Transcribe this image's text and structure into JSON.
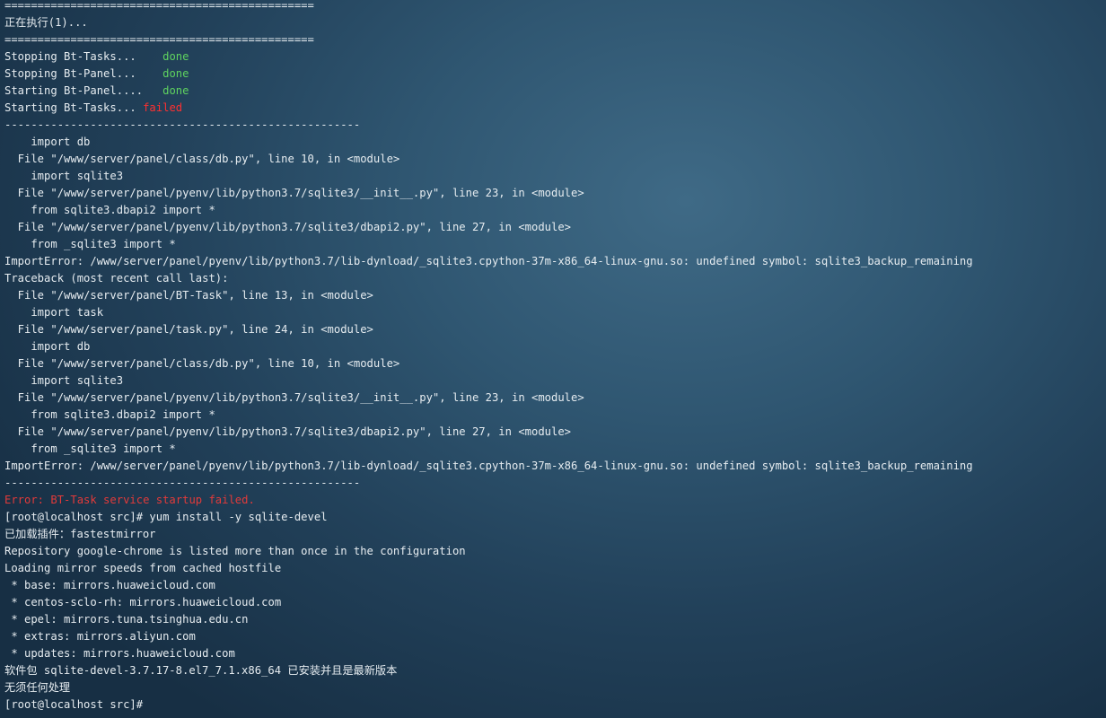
{
  "terminal": {
    "lines": [
      "===============================================",
      "正在执行(1)...",
      "===============================================",
      "Stopping Bt-Tasks...    ",
      "Stopping Bt-Panel...    ",
      "Starting Bt-Panel....   ",
      "Starting Bt-Tasks... ",
      "------------------------------------------------------",
      "    import db",
      "  File \"/www/server/panel/class/db.py\", line 10, in <module>",
      "    import sqlite3",
      "  File \"/www/server/panel/pyenv/lib/python3.7/sqlite3/__init__.py\", line 23, in <module>",
      "    from sqlite3.dbapi2 import *",
      "  File \"/www/server/panel/pyenv/lib/python3.7/sqlite3/dbapi2.py\", line 27, in <module>",
      "    from _sqlite3 import *",
      "ImportError: /www/server/panel/pyenv/lib/python3.7/lib-dynload/_sqlite3.cpython-37m-x86_64-linux-gnu.so: undefined symbol: sqlite3_backup_remaining",
      "Traceback (most recent call last):",
      "  File \"/www/server/panel/BT-Task\", line 13, in <module>",
      "    import task",
      "  File \"/www/server/panel/task.py\", line 24, in <module>",
      "    import db",
      "  File \"/www/server/panel/class/db.py\", line 10, in <module>",
      "    import sqlite3",
      "  File \"/www/server/panel/pyenv/lib/python3.7/sqlite3/__init__.py\", line 23, in <module>",
      "    from sqlite3.dbapi2 import *",
      "  File \"/www/server/panel/pyenv/lib/python3.7/sqlite3/dbapi2.py\", line 27, in <module>",
      "    from _sqlite3 import *",
      "ImportError: /www/server/panel/pyenv/lib/python3.7/lib-dynload/_sqlite3.cpython-37m-x86_64-linux-gnu.so: undefined symbol: sqlite3_backup_remaining",
      "------------------------------------------------------",
      "Error: BT-Task service startup failed.",
      "[root@localhost src]# yum install -y sqlite-devel",
      "已加载插件：fastestmirror",
      "Repository google-chrome is listed more than once in the configuration",
      "Loading mirror speeds from cached hostfile",
      " * base: mirrors.huaweicloud.com",
      " * centos-sclo-rh: mirrors.huaweicloud.com",
      " * epel: mirrors.tuna.tsinghua.edu.cn",
      " * extras: mirrors.aliyun.com",
      " * updates: mirrors.huaweicloud.com",
      "软件包 sqlite-devel-3.7.17-8.el7_7.1.x86_64 已安装并且是最新版本",
      "无须任何处理",
      "[root@localhost src]# "
    ],
    "status": {
      "done": "done",
      "failed": "failed"
    },
    "colors": {
      "text": "#e6ecf0",
      "done": "#5fd35f",
      "failed": "#ff3030",
      "error": "#e23a3a",
      "background": "#2f5671"
    }
  }
}
